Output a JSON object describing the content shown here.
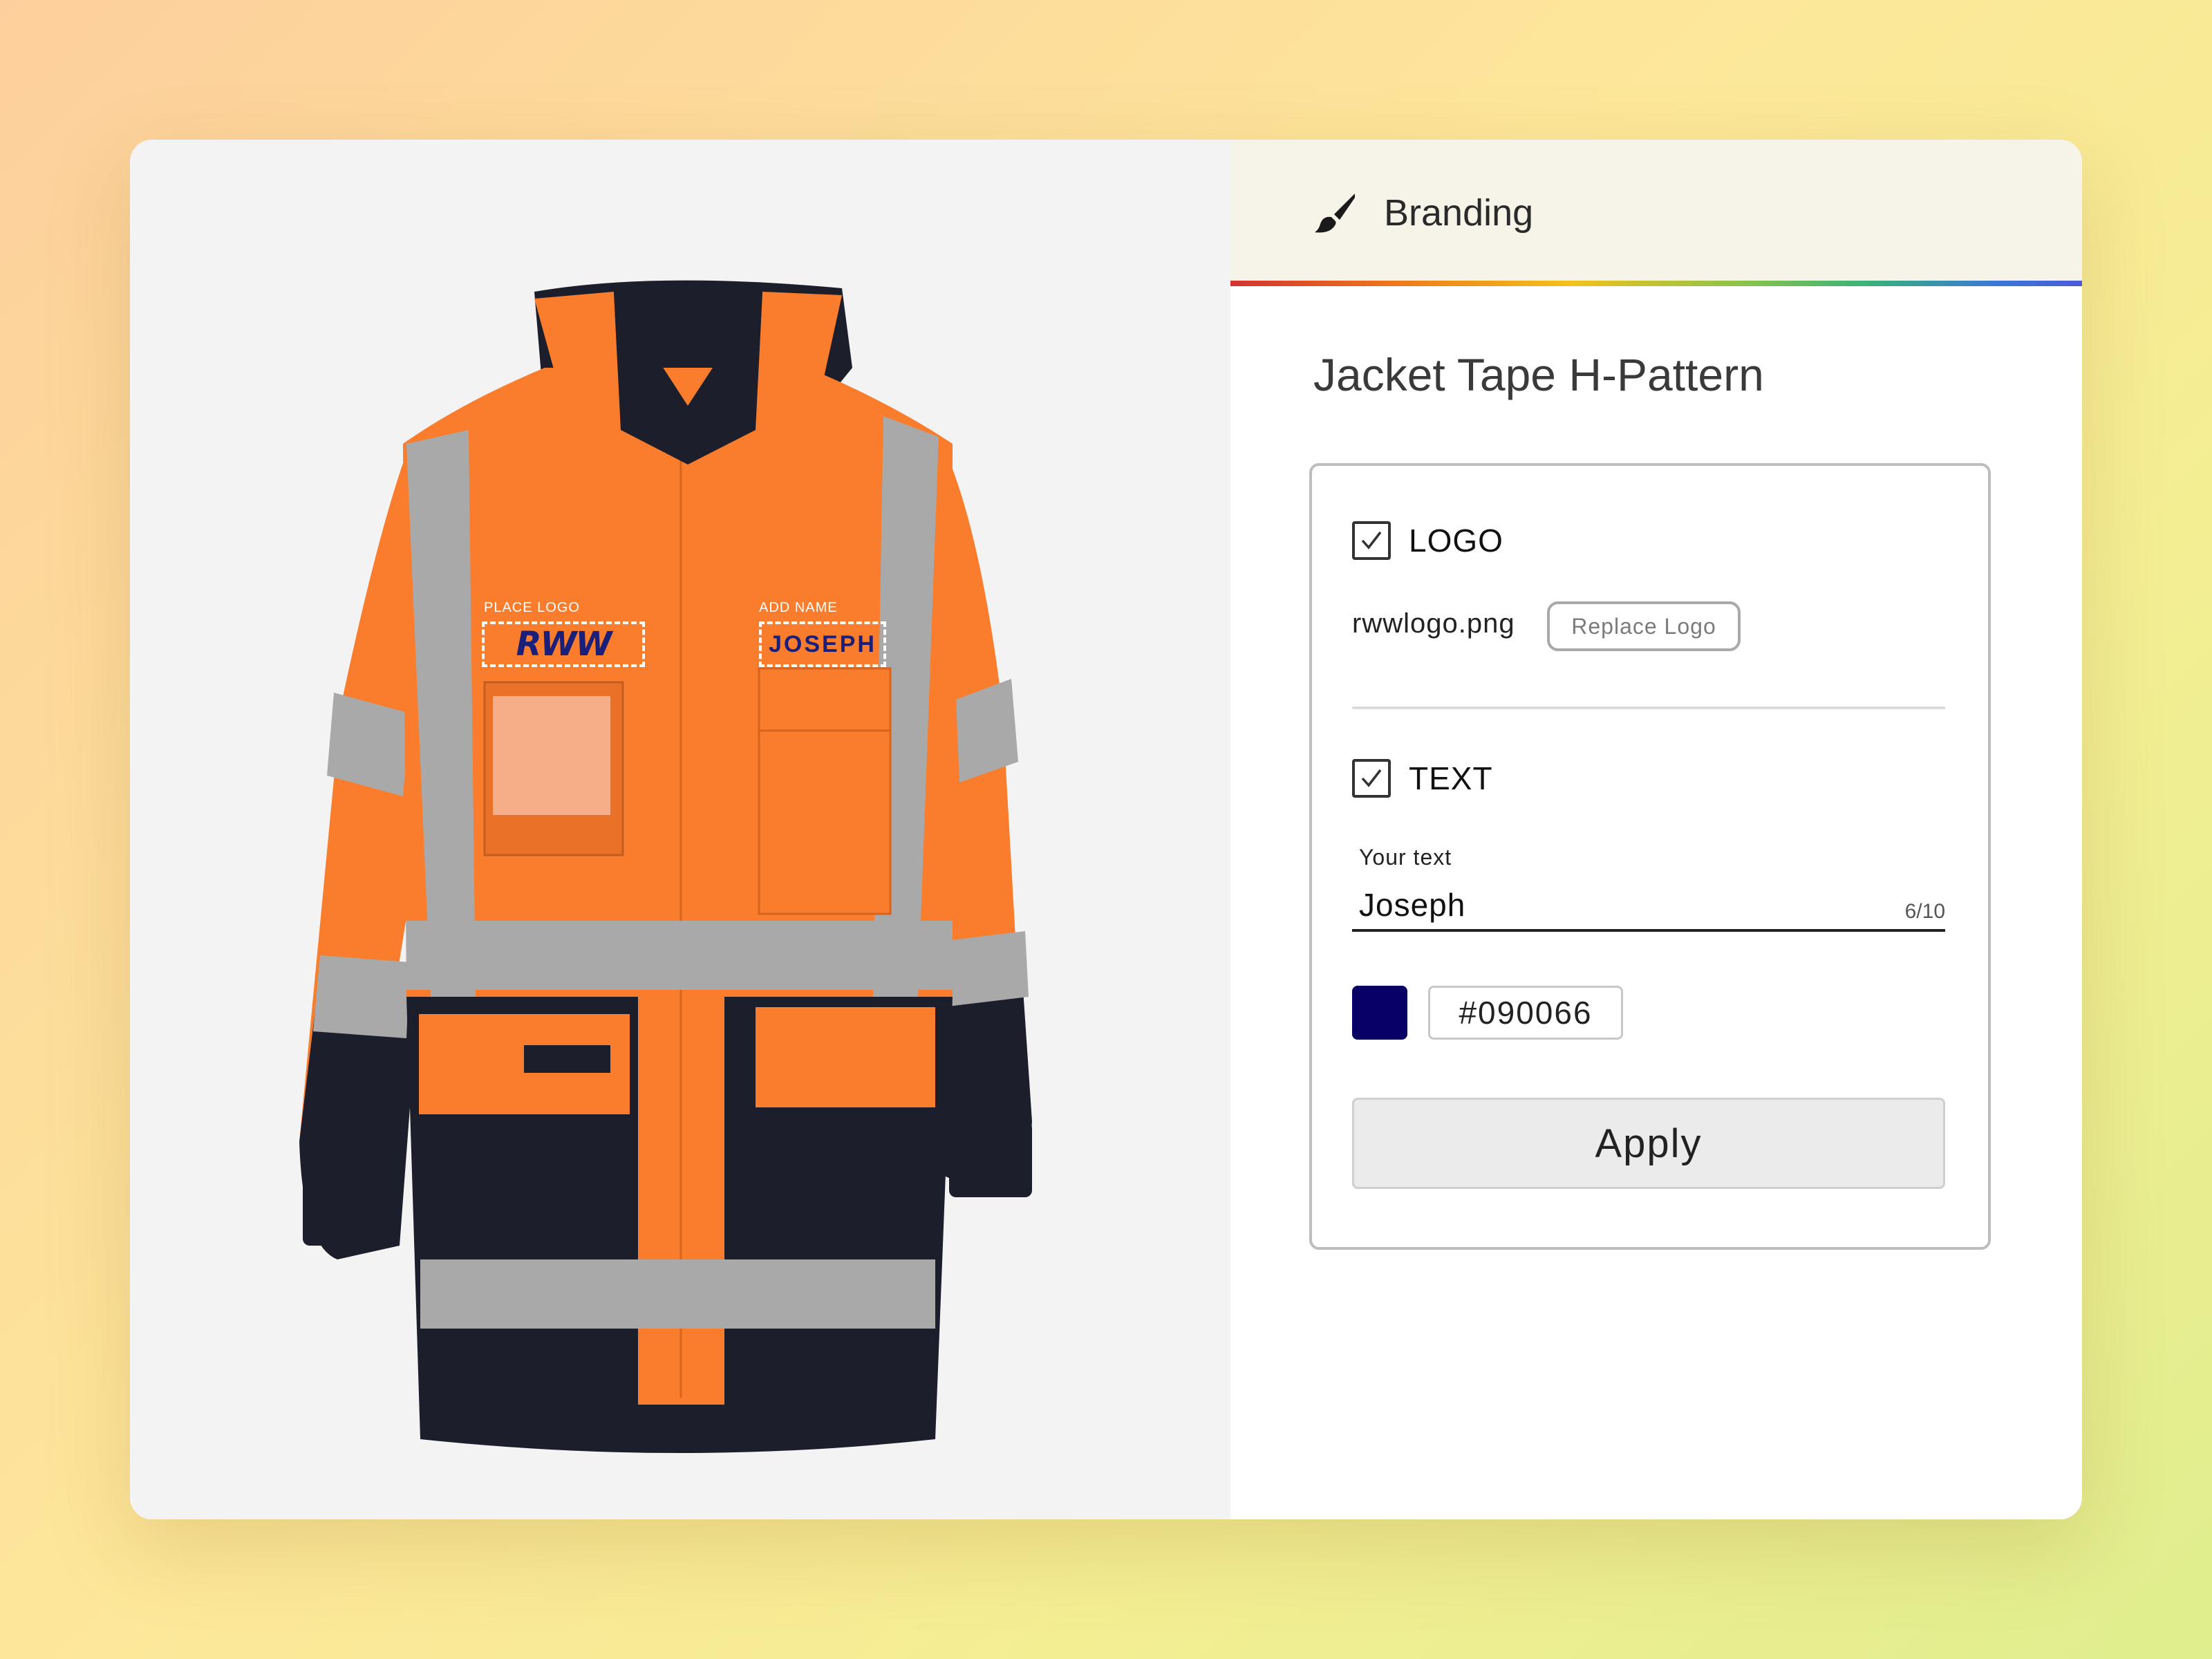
{
  "colors": {
    "jacket_orange": "#f97d2c",
    "jacket_navy": "#1c1f2b",
    "reflective_tape": "#a9a9a9",
    "text_color": "#090066"
  },
  "preview": {
    "logo_zone_label": "PLACE LOGO",
    "logo_text": "RWW",
    "name_zone_label": "ADD NAME",
    "name_text": "JOSEPH"
  },
  "panel": {
    "header_icon": "brush-icon",
    "header_title": "Branding",
    "product_title": "Jacket Tape H-Pattern",
    "logo_section": {
      "checked": true,
      "label": "LOGO",
      "file_name": "rwwlogo.png",
      "replace_label": "Replace Logo"
    },
    "text_section": {
      "checked": true,
      "label": "TEXT",
      "field_label": "Your text",
      "value": "Joseph",
      "char_count": "6/10",
      "color_hex": "#090066"
    },
    "apply_label": "Apply"
  }
}
